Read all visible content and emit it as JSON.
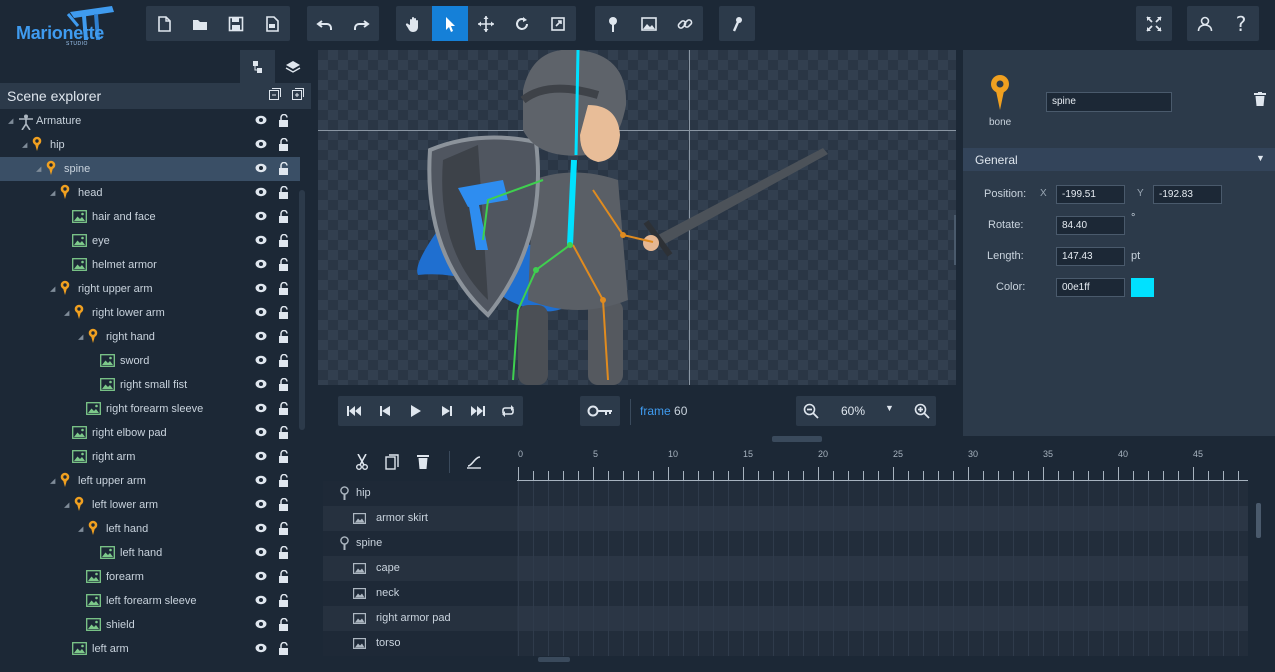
{
  "app": {
    "logo_text": "Marionette",
    "logo_sub": "STUDIO"
  },
  "toolbar": {
    "file_tools": [
      "new-file-icon",
      "open-folder-icon",
      "save-icon",
      "export-icon"
    ],
    "history_tools": [
      "undo-icon",
      "redo-icon"
    ],
    "transform_tools": [
      "hand-icon",
      "select-arrow-icon",
      "move-icon",
      "rotate-icon",
      "scale-icon"
    ],
    "create_tools": [
      "bone-pin-icon",
      "image-icon",
      "link-icon"
    ],
    "extra_tools": [
      "ik-icon"
    ],
    "active_tool": "select-arrow-icon"
  },
  "scene_explorer": {
    "title": "Scene explorer",
    "items": [
      {
        "label": "Armature",
        "type": "armature",
        "depth": 0
      },
      {
        "label": "hip",
        "type": "bone",
        "depth": 1
      },
      {
        "label": "spine",
        "type": "bone",
        "depth": 2,
        "selected": true
      },
      {
        "label": "head",
        "type": "bone",
        "depth": 3
      },
      {
        "label": "hair and face",
        "type": "image",
        "depth": 4
      },
      {
        "label": "eye",
        "type": "image",
        "depth": 4
      },
      {
        "label": "helmet armor",
        "type": "image",
        "depth": 4
      },
      {
        "label": "right upper arm",
        "type": "bone",
        "depth": 3
      },
      {
        "label": "right lower arm",
        "type": "bone",
        "depth": 4
      },
      {
        "label": "right hand",
        "type": "bone",
        "depth": 5
      },
      {
        "label": "sword",
        "type": "image",
        "depth": 6
      },
      {
        "label": "right small fist",
        "type": "image",
        "depth": 6
      },
      {
        "label": "right forearm sleeve",
        "type": "image",
        "depth": 5
      },
      {
        "label": "right elbow pad",
        "type": "image",
        "depth": 4
      },
      {
        "label": "right arm",
        "type": "image",
        "depth": 4
      },
      {
        "label": "left upper arm",
        "type": "bone",
        "depth": 3
      },
      {
        "label": "left lower arm",
        "type": "bone",
        "depth": 4
      },
      {
        "label": "left hand",
        "type": "bone",
        "depth": 5
      },
      {
        "label": "left hand",
        "type": "image",
        "depth": 6
      },
      {
        "label": "forearm",
        "type": "image",
        "depth": 5
      },
      {
        "label": "left forearm sleeve",
        "type": "image",
        "depth": 5
      },
      {
        "label": "shield",
        "type": "image",
        "depth": 5
      },
      {
        "label": "left arm",
        "type": "image",
        "depth": 4
      }
    ]
  },
  "playback": {
    "frame_label": "frame",
    "frame_value": "60",
    "zoom": "60%"
  },
  "properties": {
    "type_label": "bone",
    "name_value": "spine",
    "section": "General",
    "position_label": "Position:",
    "x_label": "X",
    "x_value": "-199.51",
    "y_label": "Y",
    "y_value": "-192.83",
    "rotate_label": "Rotate:",
    "rotate_value": "84.40",
    "rotate_unit": "°",
    "length_label": "Length:",
    "length_value": "147.43",
    "length_unit": "pt",
    "color_label": "Color:",
    "color_value": "00e1ff",
    "color_swatch": "#00e1ff"
  },
  "timeline": {
    "tick_labels": [
      "0",
      "5",
      "10",
      "15",
      "20",
      "25",
      "30",
      "35",
      "40",
      "45"
    ],
    "tracks": [
      {
        "label": "hip",
        "type": "bone"
      },
      {
        "label": "armor skirt",
        "type": "image"
      },
      {
        "label": "spine",
        "type": "bone"
      },
      {
        "label": "cape",
        "type": "image"
      },
      {
        "label": "neck",
        "type": "image"
      },
      {
        "label": "right armor pad",
        "type": "image"
      },
      {
        "label": "torso",
        "type": "image"
      }
    ]
  },
  "colors": {
    "accent": "#1580d8",
    "bone": "#f0a020",
    "panel": "#2c3a4a",
    "bg": "#1c2836"
  }
}
